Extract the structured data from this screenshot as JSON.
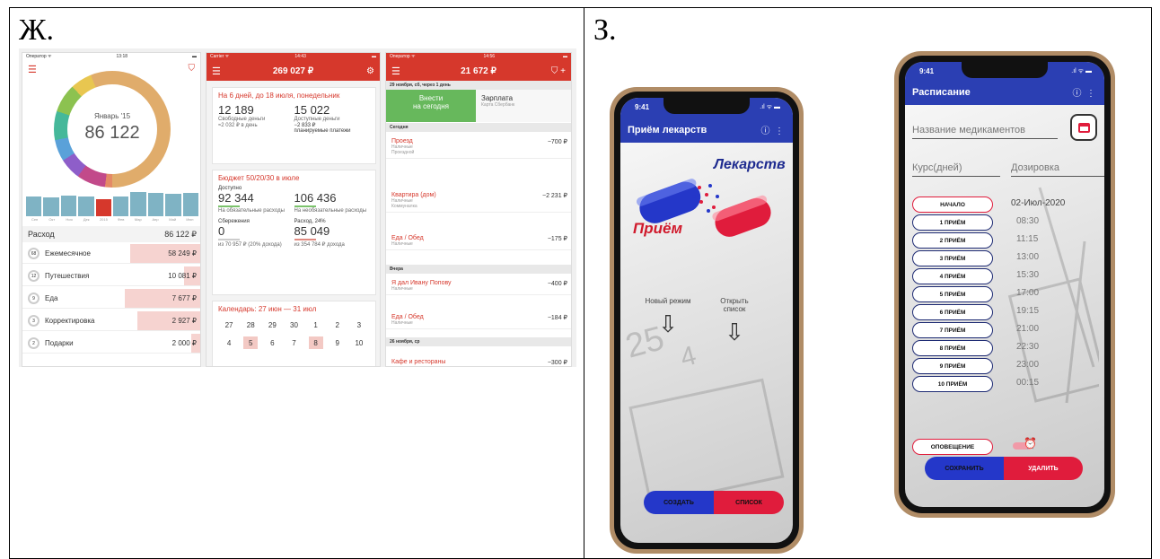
{
  "cells": {
    "left_label": "Ж.",
    "right_label": "З."
  },
  "finance": {
    "screen1": {
      "status_left": "Оператор ᯤ",
      "status_time": "13:18",
      "donut_month": "Январь '15",
      "donut_total": "86 122",
      "months": [
        "Сен",
        "Окт",
        "Ноя",
        "Дек",
        "2015",
        "Фев",
        "Мар",
        "Апр",
        "Май",
        "Июн"
      ],
      "bar_levels": [
        0.7,
        0.65,
        0.72,
        0.7,
        0.6,
        0.7,
        0.85,
        0.8,
        0.78,
        0.82
      ],
      "expense_label": "Расход",
      "expense_total": "86 122 ₽",
      "rows": [
        {
          "badge": "68",
          "name": "Ежемесячное",
          "value": "58 249 ₽",
          "level": 0.4
        },
        {
          "badge": "12",
          "name": "Путешествия",
          "value": "10 081 ₽",
          "level": 0.1
        },
        {
          "badge": "9",
          "name": "Еда",
          "value": "7 677 ₽",
          "level": 0.43
        },
        {
          "badge": "3",
          "name": "Корректировка",
          "value": "2 927 ₽",
          "level": 0.36
        },
        {
          "badge": "2",
          "name": "Подарки",
          "value": "2 000 ₽",
          "level": 0.06
        }
      ]
    },
    "screen2": {
      "status_left": "Carrier ᯤ",
      "status_time": "14:43",
      "header_amount": "269 027 ₽",
      "card1": {
        "title": "На 6 дней, до 18 июля, понедельник",
        "free_value": "12 189",
        "free_label": "Свободные деньги",
        "free_sub": "≈2 032 ₽ в день",
        "avail_value": "15 022",
        "avail_label": "Доступные деньги",
        "avail_sub": "−2 833 ₽",
        "avail_sub2": "планируемые платежи"
      },
      "card2": {
        "title": "Бюджет 50/20/30 в июле",
        "a_label": "Доступно",
        "a_value": "92 344",
        "a_sub": "На обязательные расходы",
        "b_value": "106 436",
        "b_sub": "На необязательные расходы",
        "c_label": "Сбережения",
        "c_value": "0",
        "c_sub": "из 70 957 ₽ (20% дохода)",
        "d_label": "Расход, 24%",
        "d_value": "85 049",
        "d_sub": "из 354 784 ₽ дохода"
      },
      "card3": {
        "title": "Календарь: 27 июн — 31 июл",
        "row1": [
          "27",
          "28",
          "29",
          "30",
          "1",
          "2",
          "3"
        ],
        "row2": [
          "4",
          "5",
          "6",
          "7",
          "8",
          "9",
          "10"
        ]
      }
    },
    "screen3": {
      "status_left": "Оператор ᯤ",
      "status_time": "14:56",
      "header_amount": "21 672 ₽",
      "date1": "29 ноября, сб, через 1 день",
      "btn_add": "Внести",
      "btn_add2": "на сегодня",
      "salary": "Зарплата",
      "salary_sub": "Карта Сбербанк",
      "today": "Сегодня",
      "yesterday": "Вчера",
      "date2": "26 ноября, ср",
      "tx": [
        {
          "name": "Проезд",
          "sub": "Наличные",
          "sub2": "Проездной",
          "amount": "−700 ₽"
        },
        {
          "name": "Квартира (дом)",
          "sub": "Наличные",
          "sub2": "Коммуналка",
          "amount": "−2 231 ₽"
        },
        {
          "name": "Еда / Обед",
          "sub": "Наличные",
          "sub2": "",
          "amount": "−175 ₽"
        },
        {
          "name": "Я дал Ивану Попову",
          "sub": "Наличные",
          "sub2": "",
          "amount": "−400 ₽"
        },
        {
          "name": "Еда / Обед",
          "sub": "Наличные",
          "sub2": "",
          "amount": "−184 ₽"
        },
        {
          "name": "Кафе и рестораны",
          "sub": "",
          "sub2": "",
          "amount": "−300 ₽"
        }
      ]
    }
  },
  "med_phone1": {
    "time": "9:41",
    "title": "Приём лекарств",
    "logo_word1": "Лекарств",
    "logo_word2": "Приём",
    "option1": "Новый режим",
    "option2": "Открыть список",
    "btn_create": "СОЗДАТЬ",
    "btn_list": "СПИСОК",
    "colors": {
      "header": "#2b3fb3",
      "blue": "#2437c9",
      "red": "#e01c3c"
    }
  },
  "med_phone2": {
    "time": "9:41",
    "title": "Расписание",
    "name_placeholder": "Название медикаментов",
    "course_placeholder": "Курс(дней)",
    "dose_placeholder": "Дозировка",
    "start_label": "НАЧАЛО",
    "start_date": "02-Июл-2020",
    "intakes": [
      {
        "label": "1 ПРИЁМ",
        "time": "08:30"
      },
      {
        "label": "2 ПРИЁМ",
        "time": "11:15"
      },
      {
        "label": "3 ПРИЁМ",
        "time": "13:00"
      },
      {
        "label": "4 ПРИЁМ",
        "time": "15:30"
      },
      {
        "label": "5 ПРИЁМ",
        "time": "17:00"
      },
      {
        "label": "6 ПРИЁМ",
        "time": "19:15"
      },
      {
        "label": "7 ПРИЁМ",
        "time": "21:00"
      },
      {
        "label": "8 ПРИЁМ",
        "time": "22:30"
      },
      {
        "label": "9 ПРИЁМ",
        "time": "23:00"
      },
      {
        "label": "10 ПРИЁМ",
        "time": "00:15"
      }
    ],
    "notify_label": "ОПОВЕЩЕНИЕ",
    "btn_save": "СОХРАНИТЬ",
    "btn_delete": "УДАЛИТЬ"
  }
}
